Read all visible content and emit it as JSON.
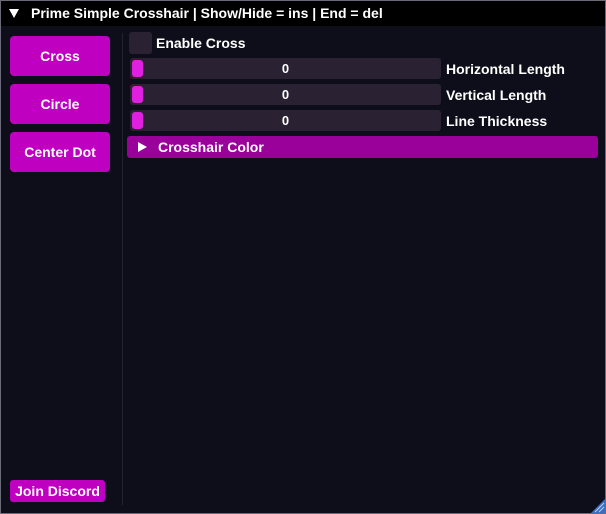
{
  "window": {
    "title": "Prime Simple Crosshair | Show/Hide = ins | End = del"
  },
  "sidebar": {
    "buttons": [
      {
        "label": "Cross"
      },
      {
        "label": "Circle"
      },
      {
        "label": "Center Dot"
      }
    ],
    "discord_label": "Join Discord"
  },
  "main": {
    "enable_cross": {
      "label": "Enable Cross",
      "checked": false
    },
    "sliders": [
      {
        "label": "Horizontal Length",
        "value": "0"
      },
      {
        "label": "Vertical Length",
        "value": "0"
      },
      {
        "label": "Line Thickness",
        "value": "0"
      }
    ],
    "color_header": {
      "label": "Crosshair Color",
      "expanded": false
    }
  },
  "icons": {
    "title_collapse": "triangle-down-icon",
    "header_expand": "triangle-right-icon",
    "resize": "resize-grip-icon"
  },
  "colors": {
    "accent": "#c000c0",
    "header": "#9a009a",
    "frame": "#2a2233",
    "background": "#0e0e1a"
  }
}
